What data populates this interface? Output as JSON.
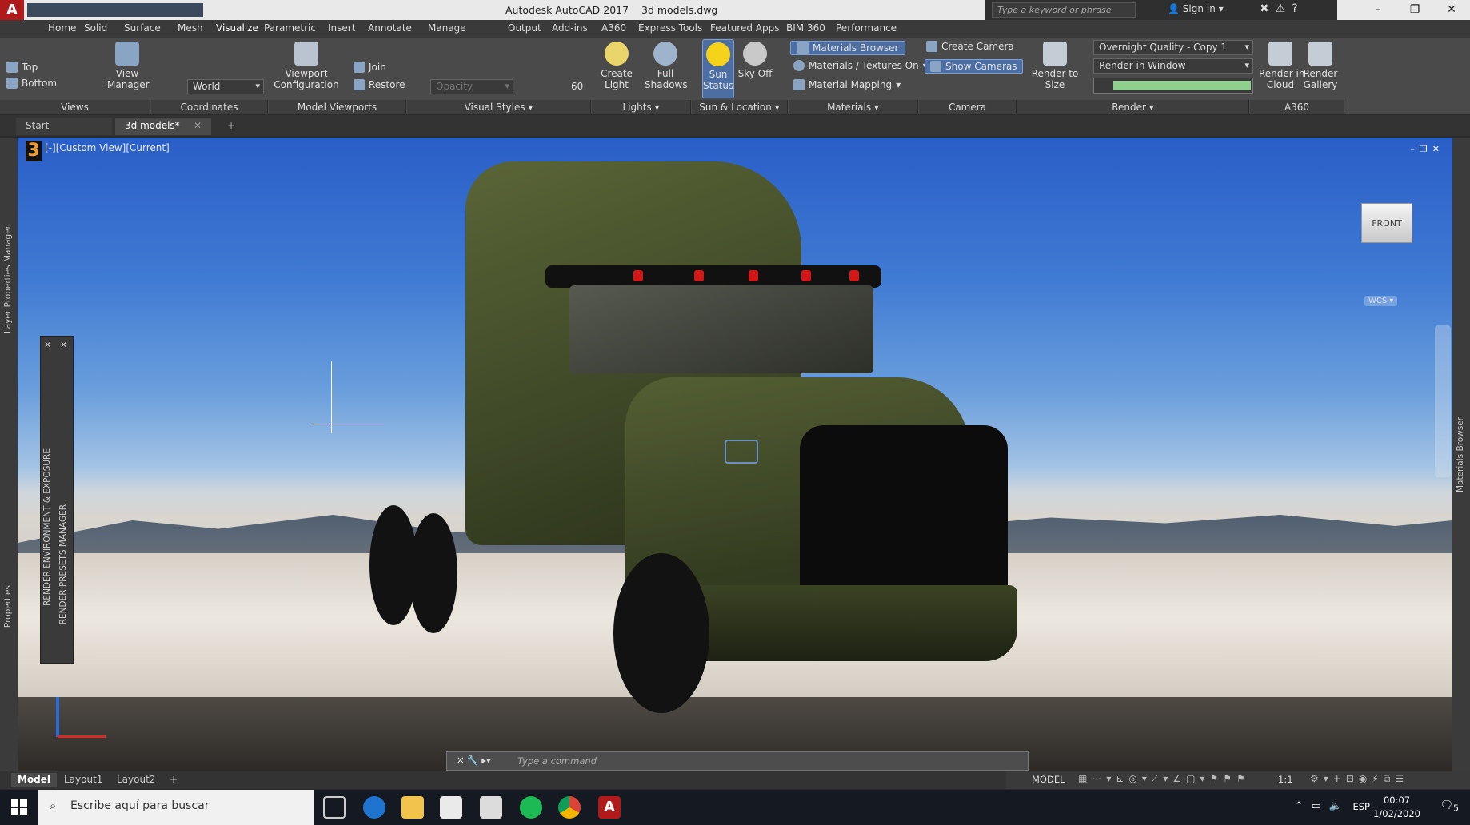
{
  "titlebar": {
    "app_title": "Autodesk AutoCAD 2017",
    "file_name": "3d models.dwg",
    "search_placeholder": "Type a keyword or phrase",
    "sign_in": "Sign In"
  },
  "ribbon_tabs": [
    "Home",
    "Solid",
    "Surface",
    "Mesh",
    "Visualize",
    "Parametric",
    "Insert",
    "Annotate",
    "Manage",
    "Output",
    "Add-ins",
    "A360",
    "Express Tools",
    "Featured Apps",
    "BIM 360",
    "Performance"
  ],
  "ribbon": {
    "views": {
      "top": "Top",
      "bottom": "Bottom",
      "view_manager": "View\nManager",
      "title": "Views"
    },
    "coordinates": {
      "world": "World",
      "title": "Coordinates"
    },
    "model_viewports": {
      "viewport_config": "Viewport\nConfiguration",
      "join": "Join",
      "restore": "Restore",
      "title": "Model Viewports"
    },
    "visual_styles": {
      "opacity": "Opacity",
      "opacity_value": "60",
      "title": "Visual Styles"
    },
    "lights": {
      "create_light": "Create\nLight",
      "full_shadows": "Full\nShadows",
      "title": "Lights"
    },
    "sun_location": {
      "sun_status": "Sun\nStatus",
      "sky_off": "Sky Off",
      "title": "Sun & Location"
    },
    "materials": {
      "materials_browser": "Materials Browser",
      "materials_textures": "Materials / Textures On",
      "material_mapping": "Material Mapping",
      "title": "Materials"
    },
    "camera": {
      "create_camera": "Create Camera",
      "show_cameras": "Show Cameras",
      "title": "Camera"
    },
    "render": {
      "render_to_size": "Render to Size",
      "quality": "Overnight Quality - Copy 1",
      "render_in": "Render in Window",
      "title": "Render"
    },
    "a360": {
      "render_cloud": "Render in\nCloud",
      "render_gallery": "Render\nGallery",
      "title": "A360"
    }
  },
  "file_tabs": [
    "Start",
    "3d models*"
  ],
  "viewport": {
    "label": "[-][Custom View][Current]",
    "viewcube_face": "FRONT",
    "wcs": "WCS"
  },
  "palettes": {
    "layer_properties": "Layer Properties Manager",
    "properties": "Properties",
    "render_env": "RENDER ENVIRONMENT & EXPOSURE",
    "render_presets": "RENDER PRESETS MANAGER",
    "materials_browser": "Materials Browser"
  },
  "command": {
    "placeholder": "Type a command"
  },
  "layout_tabs": [
    "Model",
    "Layout1",
    "Layout2"
  ],
  "status": {
    "model": "MODEL",
    "scale": "1:1"
  },
  "taskbar": {
    "search": "Escribe aquí para buscar",
    "lang": "ESP",
    "time": "00:07",
    "date": "1/02/2020",
    "notifications": "5"
  },
  "colors": {
    "accent": "#4d6ea3",
    "truck_body": "#4b5530",
    "autocad_red": "#b11a1a"
  }
}
